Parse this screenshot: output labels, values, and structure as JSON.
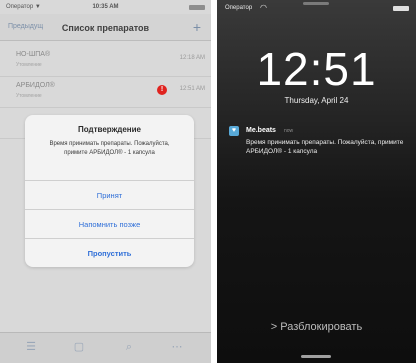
{
  "left": {
    "status": {
      "carrier": "Оператор ▼",
      "time": "10:35 AM"
    },
    "nav": {
      "back": "Предыдущ",
      "title": "Список препаратов",
      "add": "+"
    },
    "rows": [
      {
        "name": "НО-ШПА®",
        "sub": "Утомление",
        "time": "12:18 AM",
        "alert": ""
      },
      {
        "name": "АРБИДОЛ®",
        "sub": "Утомление",
        "time": "12:51 AM",
        "alert": "!"
      },
      {
        "name": "",
        "sub": "",
        "time": "",
        "alert": ""
      },
      {
        "name": "",
        "sub": "",
        "time": "",
        "alert": ""
      }
    ],
    "dialog": {
      "title": "Подтверждение",
      "message": "Время принимать препараты. Пожалуйста, примите АРБИДОЛ® - 1 капсула",
      "buttons": [
        "Принят",
        "Напомнить позже",
        "Пропустить"
      ]
    },
    "tabs": [
      "☰",
      "▢",
      "⌕",
      "⋯"
    ]
  },
  "right": {
    "status": {
      "carrier": "Оператор",
      "wifi": "◠"
    },
    "clock": "12:51",
    "date": "Thursday, April 24",
    "notification": {
      "app": "Me.beats",
      "when": "now",
      "text": "Время принимать препараты. Пожалуйста, примите АРБИДОЛ® - 1 капсула"
    },
    "unlock": "> Разблокировать"
  }
}
